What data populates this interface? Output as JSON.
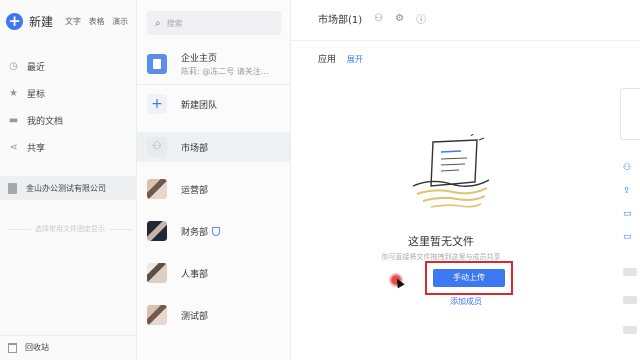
{
  "sidebar": {
    "new_label": "新建",
    "new_types": [
      "文字",
      "表格",
      "演示"
    ],
    "nav": [
      {
        "label": "最近",
        "icon": "clock-icon"
      },
      {
        "label": "星标",
        "icon": "star-icon"
      },
      {
        "label": "我的文档",
        "icon": "folder-icon"
      },
      {
        "label": "共享",
        "icon": "share-icon"
      }
    ],
    "company": "金山办公测试有限公司",
    "faded_text": "选择常用文件固定显示",
    "recycle": "回收站"
  },
  "middle": {
    "search_placeholder": "搜索",
    "enterprise": {
      "title": "企业主页",
      "subtitle": "陈莉: @冻二号 请关注..."
    },
    "teams": [
      {
        "label": "新建团队",
        "avatar": "plus-icon"
      },
      {
        "label": "市场部",
        "avatar": "people-icon"
      },
      {
        "label": "运营部",
        "avatar": "photo"
      },
      {
        "label": "财务部",
        "avatar": "photo"
      },
      {
        "label": "人事部",
        "avatar": "photo"
      },
      {
        "label": "测试部",
        "avatar": "photo"
      }
    ]
  },
  "main": {
    "title": "市场部(1)",
    "apps_label": "应用",
    "apps_expand": "展开",
    "empty_title": "这里暂无文件",
    "empty_desc": "你可直接将文件拖拽到这里与成员共享",
    "upload_button": "手动上传",
    "add_member": "添加成员"
  },
  "colors": {
    "accent": "#3d78f3",
    "highlight_box": "#d9282f"
  }
}
